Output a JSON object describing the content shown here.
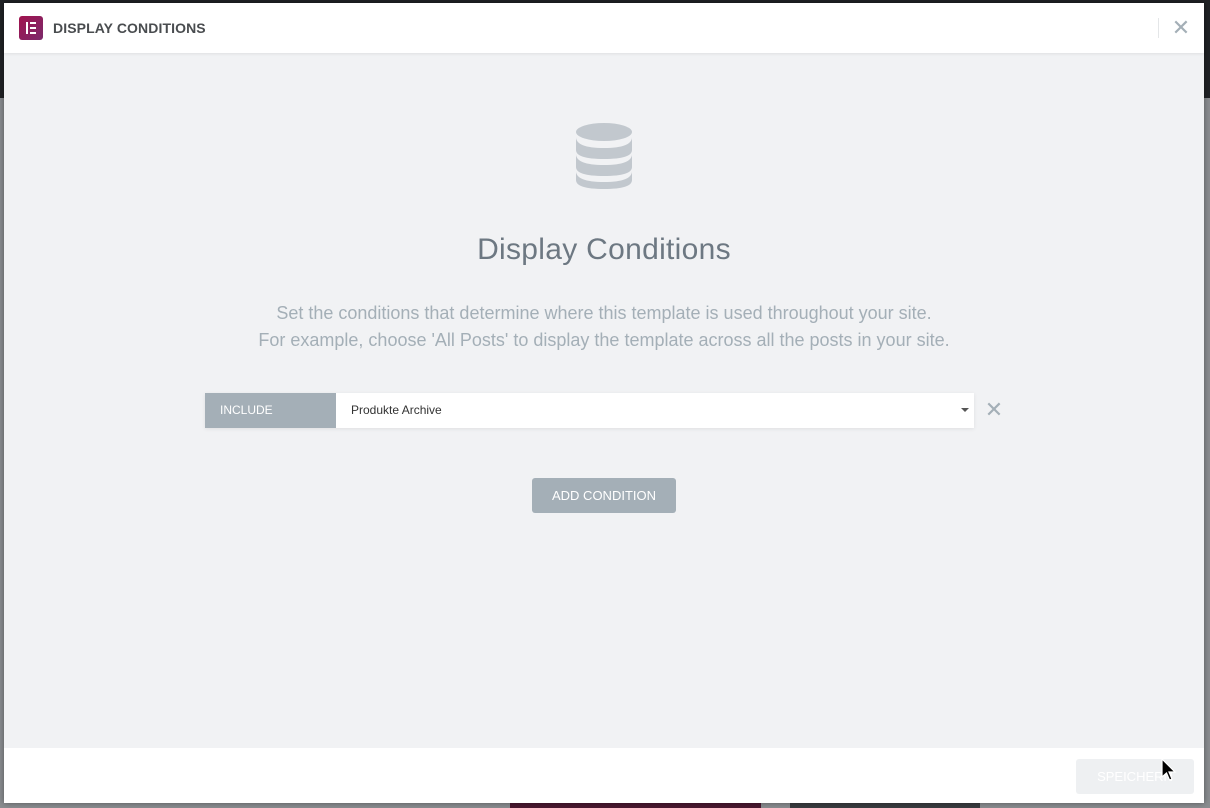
{
  "header": {
    "title": "DISPLAY CONDITIONS",
    "logo_icon": "elementor-logo-icon",
    "close_icon": "close-icon"
  },
  "main": {
    "icon": "database-icon",
    "title": "Display Conditions",
    "description_line1": "Set the conditions that determine where this template is used throughout your site.",
    "description_line2": "For example, choose 'All Posts' to display the template across all the posts in your site."
  },
  "conditions": [
    {
      "type": "INCLUDE",
      "value": "Produkte Archive"
    }
  ],
  "add_condition_label": "ADD CONDITION",
  "footer": {
    "save_label": "SPEICHERN"
  },
  "colors": {
    "accent": "#92003b",
    "muted": "#a4afb7",
    "title": "#6d7882",
    "background": "#f1f2f4"
  }
}
